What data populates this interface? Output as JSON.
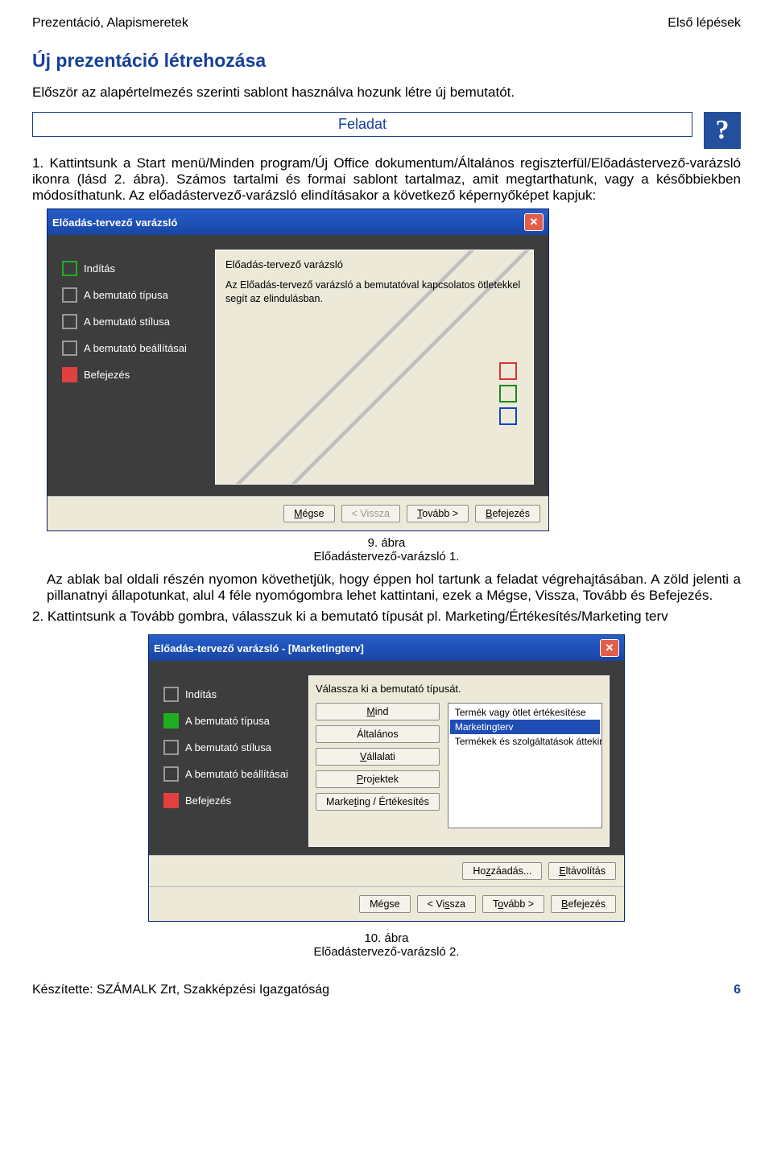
{
  "header": {
    "left": "Prezentáció, Alapismeretek",
    "right": "Első lépések"
  },
  "section_title": "Új prezentáció létrehozása",
  "intro": "Először az alapértelmezés szerinti sablont használva hozunk létre új bemutatót.",
  "feladat_label": "Feladat",
  "help_icon": "?",
  "step1_num": "1.",
  "step1_text": "Kattintsunk a Start menü/Minden program/Új Office dokumentum/Általános regiszterfül/Előadástervező-varázsló ikonra (lásd 2. ábra). Számos tartalmi és formai sablont tartalmaz, amit megtarthatunk, vagy a későbbiekben módosíthatunk. Az előadástervező-varázsló elindításakor a következő képernyőképet kapjuk:",
  "wizard1": {
    "title": "Előadás-tervező varázsló",
    "steps": [
      "Indítás",
      "A bemutató típusa",
      "A bemutató stílusa",
      "A bemutató beállításai",
      "Befejezés"
    ],
    "preview_title": "Előadás-tervező varázsló",
    "preview_text": "Az Előadás-tervező varázsló a bemutatóval kapcsolatos ötletekkel segít az elindulásban.",
    "btn_cancel": "Mégse",
    "btn_back": "< Vissza",
    "btn_next": "Tovább >",
    "btn_finish": "Befejezés"
  },
  "caption1_a": "9. ábra",
  "caption1_b": "Előadástervező-varázsló 1.",
  "para_after1": "Az ablak bal oldali részén nyomon követhetjük, hogy éppen hol tartunk a feladat végrehajtásában. A zöld jelenti a pillanatnyi állapotunkat, alul 4 féle nyomógombra lehet kattintani, ezek a Mégse, Vissza, Tovább és Befejezés.",
  "step2_num": "2.",
  "step2_text": "Kattintsunk a Tovább gombra, válasszuk ki a bemutató típusát pl. Marketing/Értékesítés/Marketing terv",
  "wizard2": {
    "title": "Előadás-tervező varázsló - [Marketingterv]",
    "prompt": "Válassza ki a bemutató típusát.",
    "cat_buttons": [
      "Mind",
      "Általános",
      "Vállalati",
      "Projektek",
      "Marketing / Értékesítés"
    ],
    "list_items": [
      "Termék vagy ötlet értékesítése",
      "Marketingterv",
      "Termékek és szolgáltatások áttekintése"
    ],
    "selected_index": 1,
    "btn_add": "Hozzáadás...",
    "btn_remove": "Eltávolítás",
    "btn_cancel": "Mégse",
    "btn_back": "< Vissza",
    "btn_next": "Tovább >",
    "btn_finish": "Befejezés"
  },
  "caption2_a": "10. ábra",
  "caption2_b": "Előadástervező-varázsló 2.",
  "footer": {
    "left": "Készítette: SZÁMALK Zrt, Szakképzési Igazgatóság",
    "page": "6"
  }
}
